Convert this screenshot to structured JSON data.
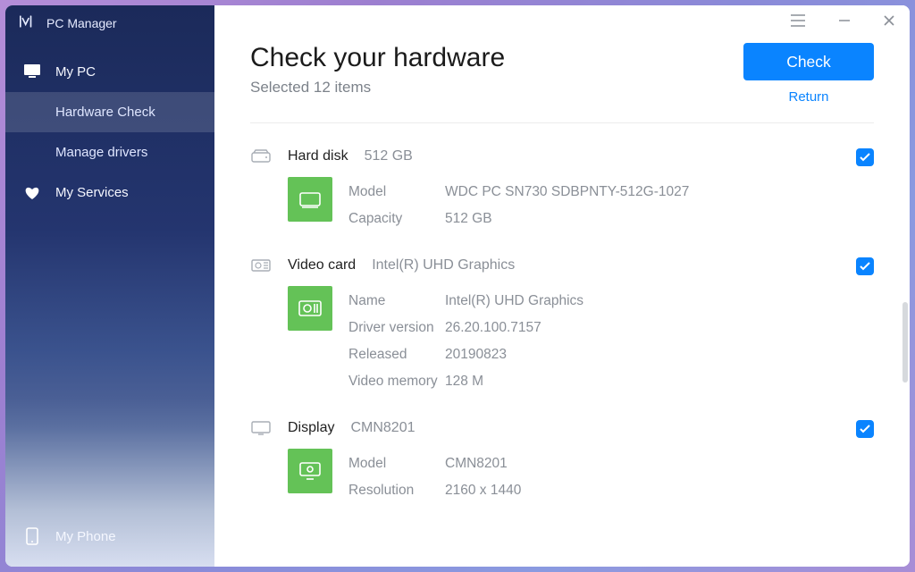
{
  "app": {
    "title": "PC Manager"
  },
  "sidebar": {
    "my_pc": "My PC",
    "hardware_check": "Hardware Check",
    "manage_drivers": "Manage drivers",
    "my_services": "My Services",
    "my_phone": "My Phone"
  },
  "main": {
    "title": "Check your hardware",
    "subtitle": "Selected 12 items",
    "check_button": "Check",
    "return_link": "Return"
  },
  "hardware": [
    {
      "name": "Hard disk",
      "summary": "512 GB",
      "checked": true,
      "props": [
        {
          "k": "Model",
          "v": "WDC PC SN730 SDBPNTY-512G-1027"
        },
        {
          "k": "Capacity",
          "v": "512 GB"
        }
      ]
    },
    {
      "name": "Video card",
      "summary": "Intel(R) UHD Graphics",
      "checked": true,
      "props": [
        {
          "k": "Name",
          "v": "Intel(R) UHD Graphics"
        },
        {
          "k": "Driver version",
          "v": "26.20.100.7157"
        },
        {
          "k": "Released",
          "v": "20190823"
        },
        {
          "k": "Video memory",
          "v": "128 M"
        }
      ]
    },
    {
      "name": "Display",
      "summary": "CMN8201",
      "checked": true,
      "props": [
        {
          "k": "Model",
          "v": "CMN8201"
        },
        {
          "k": "Resolution",
          "v": "2160 x 1440"
        }
      ]
    }
  ],
  "colors": {
    "accent": "#0a84ff",
    "tile": "#64c257"
  }
}
